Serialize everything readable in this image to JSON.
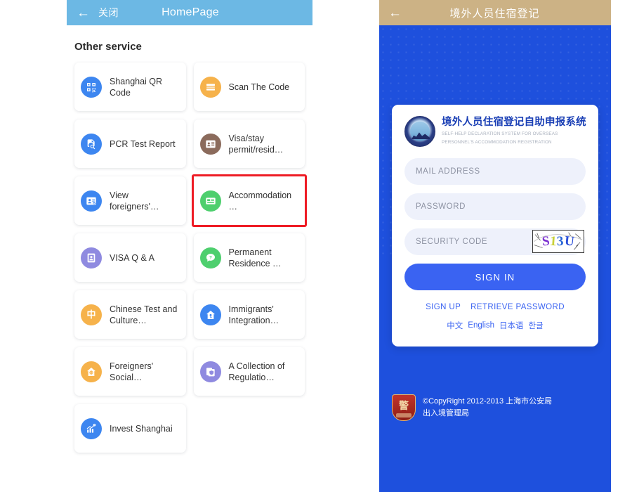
{
  "left_panel": {
    "header": {
      "back_icon": "arrow-left-icon",
      "close_label": "关闭",
      "title": "HomePage"
    },
    "section_title": "Other service",
    "services": [
      {
        "label": "Shanghai QR Code",
        "icon": "qr-code-icon",
        "color": "#3d86f0",
        "highlighted": false
      },
      {
        "label": "Scan The Code",
        "icon": "scan-icon",
        "color": "#f6b24b",
        "highlighted": false
      },
      {
        "label": "PCR Test Report",
        "icon": "document-search-icon",
        "color": "#3d86f0",
        "highlighted": false
      },
      {
        "label": "Visa/stay permit/resid…",
        "icon": "id-card-icon",
        "color": "#8b6b5c",
        "highlighted": false
      },
      {
        "label": "View foreigners'…",
        "icon": "person-card-icon",
        "color": "#3d86f0",
        "highlighted": false
      },
      {
        "label": "Accommodation…",
        "icon": "bed-icon",
        "color": "#4ecf6e",
        "highlighted": true
      },
      {
        "label": "VISA Q & A",
        "icon": "passport-photo-icon",
        "color": "#8f8ae0",
        "highlighted": false
      },
      {
        "label": "Permanent Residence …",
        "icon": "question-bubble-icon",
        "color": "#4ecf6e",
        "highlighted": false
      },
      {
        "label": "Chinese Test and Culture…",
        "icon": "chinese-character-icon",
        "color": "#f6b24b",
        "highlighted": false
      },
      {
        "label": "Immigrants' Integration…",
        "icon": "house-key-icon",
        "color": "#3d86f0",
        "highlighted": false
      },
      {
        "label": "Foreigners' Social…",
        "icon": "house-globe-icon",
        "color": "#f6b24b",
        "highlighted": false
      },
      {
        "label": "A Collection of Regulatio…",
        "icon": "documents-shield-icon",
        "color": "#8f8ae0",
        "highlighted": false
      },
      {
        "label": "Invest Shanghai",
        "icon": "bar-chart-icon",
        "color": "#3d86f0",
        "highlighted": false
      }
    ]
  },
  "right_panel": {
    "header": {
      "back_icon": "arrow-left-icon",
      "title": "境外人员住宿登记",
      "background_color": "#ccb285"
    },
    "brand": {
      "seal_icon": "police-seal-icon",
      "title_cn": "境外人员住宿登记自助申报系统",
      "subtitle_en_line1": "SELF-HELP DECLARATION SYSTEM FOR OVERSEAS",
      "subtitle_en_line2": "PERSONNEL'S ACCOMMODATION REGISTRATION"
    },
    "form": {
      "mail_placeholder": "MAIL ADDRESS",
      "mail_value": "",
      "password_placeholder": "PASSWORD",
      "password_value": "",
      "security_placeholder": "SECURITY CODE",
      "security_value": "",
      "captcha_chars": [
        "S",
        "1",
        "3",
        "U"
      ],
      "captcha_colors": [
        "#7a2fd0",
        "#c9d13a",
        "#2563d6",
        "#2b4fd8"
      ],
      "signin_label": "SIGN IN",
      "signin_color": "#3a63f2"
    },
    "links": {
      "sign_up": "SIGN UP",
      "retrieve_password": "RETRIEVE PASSWORD"
    },
    "languages": [
      "中文",
      "English",
      "日本语",
      "한글"
    ],
    "copyright": {
      "badge_icon": "police-shield-icon",
      "line1": "©CopyRight 2012-2013 上海市公安局",
      "line2": "出入境管理局"
    },
    "background_color": "#1e50dd"
  }
}
